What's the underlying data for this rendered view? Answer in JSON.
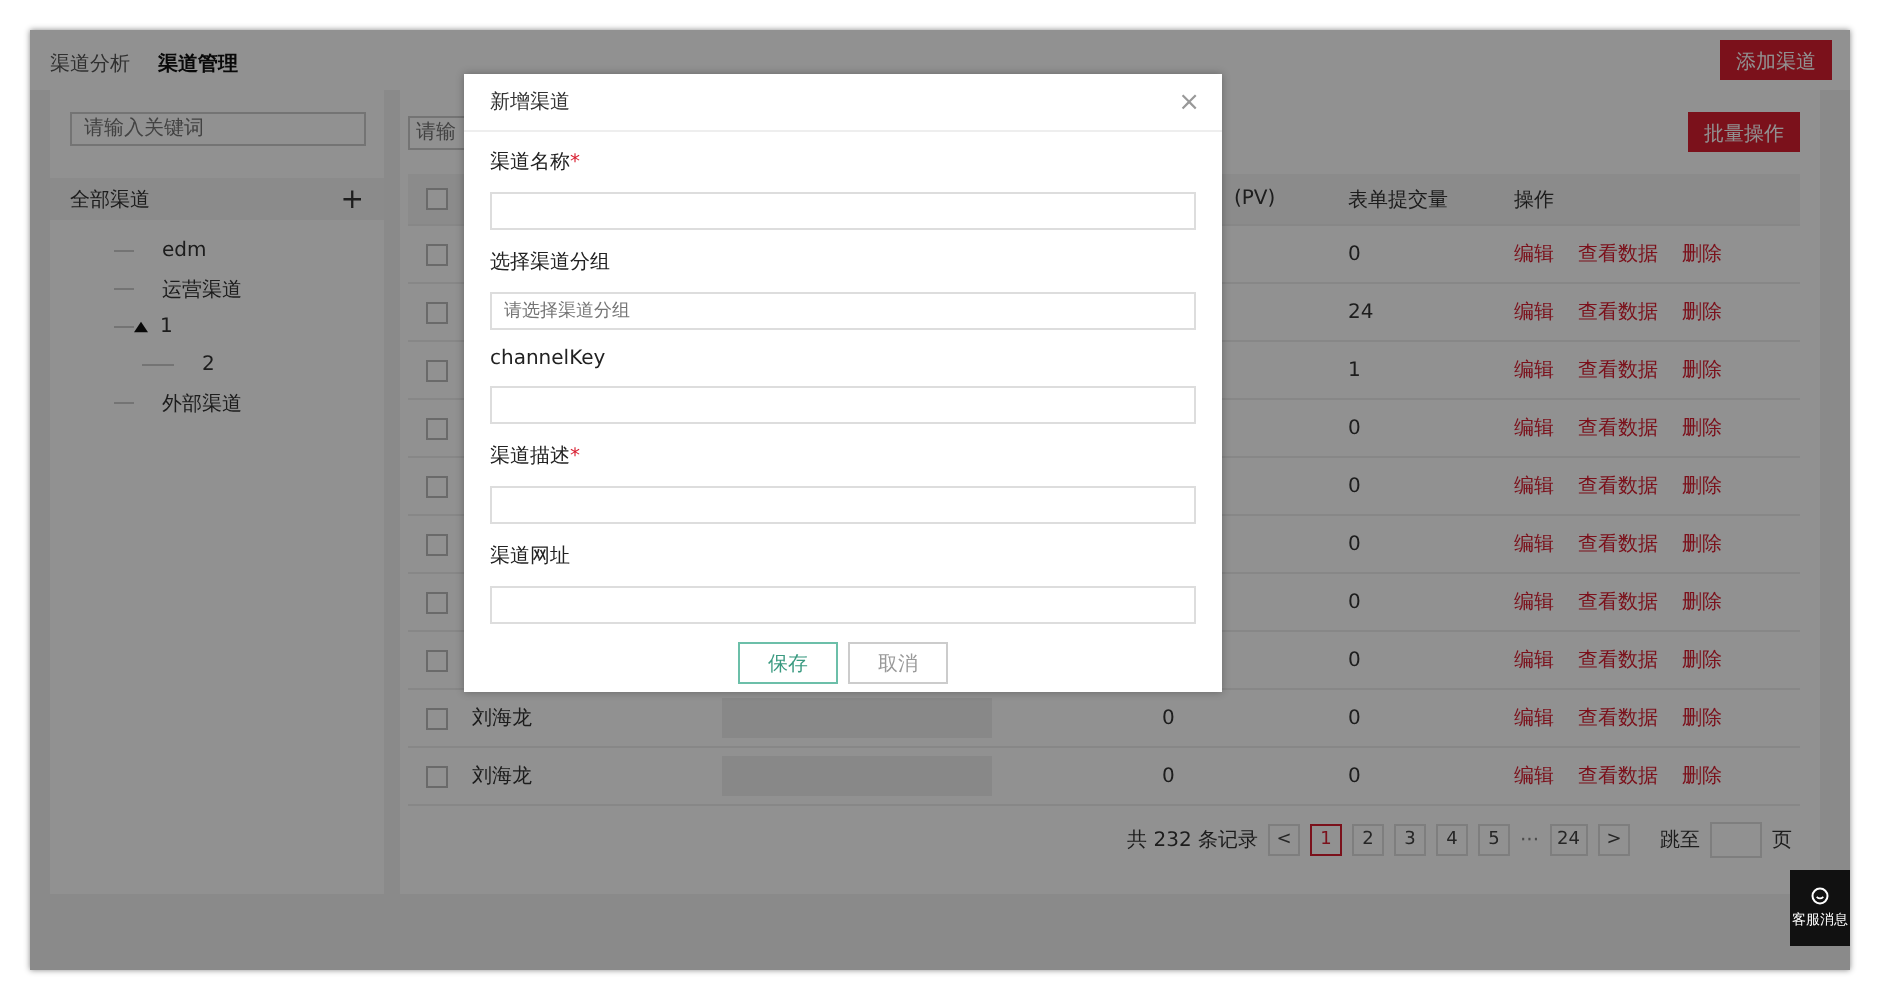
{
  "tabs": [
    {
      "label": "渠道分析",
      "selected": false
    },
    {
      "label": "渠道管理",
      "selected": true
    }
  ],
  "add_button": "添加渠道",
  "sidebar": {
    "search": {
      "placeholder": "请输入关键词"
    },
    "title": "全部渠道",
    "add_icon": "+",
    "tree": [
      {
        "label": "edm"
      },
      {
        "label": "运营渠道"
      },
      {
        "label": "1",
        "expanded": true,
        "children": [
          {
            "label": "2"
          }
        ]
      },
      {
        "label": "外部渠道"
      }
    ]
  },
  "main": {
    "search": {
      "placeholder": "请输"
    },
    "batch_button": "批量操作"
  },
  "table": {
    "header_checked": false,
    "columns": [
      "(PV)",
      "表单提交量",
      "操作"
    ],
    "rows": [
      {
        "checked": false,
        "submissions": "0",
        "actions": [
          "编辑",
          "查看数据",
          "删除"
        ]
      },
      {
        "checked": false,
        "submissions": "24",
        "actions": [
          "编辑",
          "查看数据",
          "删除"
        ]
      },
      {
        "checked": false,
        "submissions": "1",
        "actions": [
          "编辑",
          "查看数据",
          "删除"
        ]
      },
      {
        "checked": false,
        "submissions": "0",
        "actions": [
          "编辑",
          "查看数据",
          "删除"
        ]
      },
      {
        "checked": false,
        "submissions": "0",
        "actions": [
          "编辑",
          "查看数据",
          "删除"
        ]
      },
      {
        "checked": false,
        "submissions": "0",
        "actions": [
          "编辑",
          "查看数据",
          "删除"
        ]
      },
      {
        "checked": false,
        "submissions": "0",
        "actions": [
          "编辑",
          "查看数据",
          "删除"
        ]
      },
      {
        "checked": false,
        "submissions": "0",
        "actions": [
          "编辑",
          "查看数据",
          "删除"
        ]
      },
      {
        "checked": false,
        "name": "刘海龙",
        "pv": "0",
        "submissions": "0",
        "actions": [
          "编辑",
          "查看数据",
          "删除"
        ]
      },
      {
        "checked": false,
        "name": "刘海龙",
        "pv": "0",
        "submissions": "0",
        "actions": [
          "编辑",
          "查看数据",
          "删除"
        ]
      }
    ]
  },
  "pagination": {
    "total": "共 232 条记录",
    "prev": "<",
    "next": ">",
    "pages": [
      {
        "label": "1",
        "kind": "page",
        "selected": true
      },
      {
        "label": "2",
        "kind": "page",
        "selected": false
      },
      {
        "label": "3",
        "kind": "page",
        "selected": false
      },
      {
        "label": "4",
        "kind": "page",
        "selected": false
      },
      {
        "label": "5",
        "kind": "page",
        "selected": false
      },
      {
        "label": "···",
        "kind": "ellipsis"
      },
      {
        "label": "24",
        "kind": "page",
        "selected": false
      }
    ],
    "jump_label": "跳至",
    "jump_suffix": "页"
  },
  "float_button": "客服消息",
  "dialog": {
    "title": "新增渠道",
    "close": "×",
    "fields": [
      {
        "label": "渠道名称",
        "required": true,
        "marker": "*"
      },
      {
        "label": "选择渠道分组",
        "placeholder": "请选择渠道分组"
      },
      {
        "label": "channelKey"
      },
      {
        "label": "渠道描述",
        "required": true,
        "marker": "*"
      },
      {
        "label": "渠道网址"
      }
    ],
    "buttons": [
      {
        "label": "保存",
        "kind": "primary"
      },
      {
        "label": "取消",
        "kind": "default"
      }
    ]
  }
}
